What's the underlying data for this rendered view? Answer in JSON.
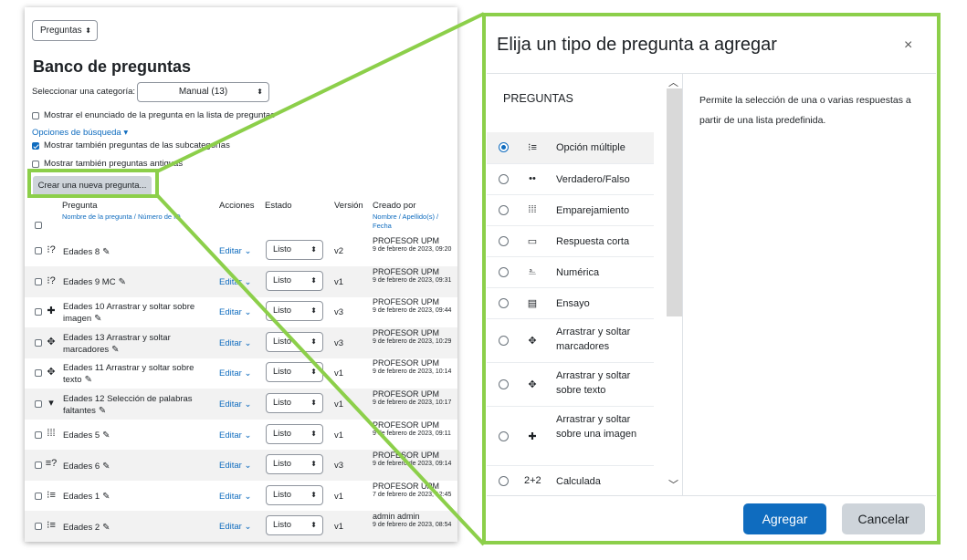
{
  "bank": {
    "top_select": "Preguntas",
    "title": "Banco de preguntas",
    "category_label": "Seleccionar una categoría:",
    "category_value": "Manual (13)",
    "show_statement": "Mostrar el enunciado de la pregunta en la lista de preguntas",
    "search_options": "Opciones de búsqueda",
    "show_subcategories": "Mostrar también preguntas de las subcategorías",
    "show_old": "Mostrar también preguntas antiguas",
    "create_button": "Crear una nueva pregunta...",
    "columns": {
      "question": "Pregunta",
      "question_sub": "Nombre de la pregunta / Número de ID",
      "actions": "Acciones",
      "state": "Estado",
      "version": "Versión",
      "created_by": "Creado por",
      "created_sub": "Nombre / Apellido(s) / Fecha"
    },
    "rows": [
      {
        "icon": "matching-icon",
        "glyph": "⁝?",
        "name": "Edades 8",
        "edit": "Editar",
        "state": "Listo",
        "version": "v2",
        "author": "PROFESOR UPM",
        "date": "9 de febrero de 2023, 09:20"
      },
      {
        "icon": "multichoice-icon",
        "glyph": "⁝?",
        "name": "Edades 9 MC",
        "edit": "Editar",
        "state": "Listo",
        "version": "v1",
        "author": "PROFESOR UPM",
        "date": "9 de febrero de 2023, 09:31"
      },
      {
        "icon": "drag-image-icon",
        "glyph": "✚",
        "name": "Edades 10 Arrastrar y soltar sobre imagen",
        "edit": "Editar",
        "state": "Listo",
        "version": "v3",
        "author": "PROFESOR UPM",
        "date": "9 de febrero de 2023, 09:44"
      },
      {
        "icon": "drag-markers-icon",
        "glyph": "✥",
        "name": "Edades 13 Arrastrar y soltar marcadores",
        "edit": "Editar",
        "state": "Listo",
        "version": "v3",
        "author": "PROFESOR UPM",
        "date": "9 de febrero de 2023, 10:29"
      },
      {
        "icon": "drag-text-icon",
        "glyph": "✥",
        "name": "Edades 11 Arrastrar y soltar sobre texto",
        "edit": "Editar",
        "state": "Listo",
        "version": "v1",
        "author": "PROFESOR UPM",
        "date": "9 de febrero de 2023, 10:14"
      },
      {
        "icon": "gapselect-icon",
        "glyph": "▾",
        "name": "Edades 12 Selección de palabras faltantes",
        "edit": "Editar",
        "state": "Listo",
        "version": "v1",
        "author": "PROFESOR UPM",
        "date": "9 de febrero de 2023, 10:17"
      },
      {
        "icon": "matching-icon",
        "glyph": "⁞⁞⁞",
        "name": "Edades 5",
        "edit": "Editar",
        "state": "Listo",
        "version": "v1",
        "author": "PROFESOR UPM",
        "date": "9 de febrero de 2023, 09:11"
      },
      {
        "icon": "randomsa-icon",
        "glyph": "≡?",
        "name": "Edades 6",
        "edit": "Editar",
        "state": "Listo",
        "version": "v3",
        "author": "PROFESOR UPM",
        "date": "9 de febrero de 2023, 09:14"
      },
      {
        "icon": "multichoice-icon",
        "glyph": "⁝≡",
        "name": "Edades 1",
        "edit": "Editar",
        "state": "Listo",
        "version": "v1",
        "author": "PROFESOR UPM",
        "date": "7 de febrero de 2023, 12:45"
      },
      {
        "icon": "multichoice-icon",
        "glyph": "⁝≡",
        "name": "Edades 2",
        "edit": "Editar",
        "state": "Listo",
        "version": "v1",
        "author": "admin admin",
        "date": "9 de febrero de 2023, 08:54"
      }
    ]
  },
  "modal": {
    "title": "Elija un tipo de pregunta a agregar",
    "close": "×",
    "section": "PREGUNTAS",
    "description": "Permite la selección de una o varias respuestas a partir de una lista predefinida.",
    "options": [
      {
        "label": "Opción múltiple",
        "icon": "multichoice-icon",
        "glyph": "⁝≡",
        "selected": true
      },
      {
        "label": "Verdadero/Falso",
        "icon": "truefalse-icon",
        "glyph": "••",
        "selected": false
      },
      {
        "label": "Emparejamiento",
        "icon": "matching-icon",
        "glyph": "⁞⁞⁞",
        "selected": false
      },
      {
        "label": "Respuesta corta",
        "icon": "shortanswer-icon",
        "glyph": "▭",
        "selected": false
      },
      {
        "label": "Numérica",
        "icon": "numerical-icon",
        "glyph": "⎁",
        "selected": false
      },
      {
        "label": "Ensayo",
        "icon": "essay-icon",
        "glyph": "▤",
        "selected": false
      },
      {
        "label": "Arrastrar y soltar marcadores",
        "icon": "drag-markers-icon",
        "glyph": "✥",
        "selected": false
      },
      {
        "label": "Arrastrar y soltar sobre texto",
        "icon": "drag-text-icon",
        "glyph": "✥",
        "selected": false
      },
      {
        "label": "Arrastrar y soltar sobre una imagen",
        "icon": "drag-image-icon",
        "glyph": "✚",
        "selected": false
      },
      {
        "label": "Calculada",
        "icon": "calculated-icon",
        "glyph": "2+2",
        "selected": false
      }
    ],
    "add_button": "Agregar",
    "cancel_button": "Cancelar"
  },
  "colors": {
    "accent": "#0f6cbf",
    "highlight": "#8ccf4a"
  }
}
